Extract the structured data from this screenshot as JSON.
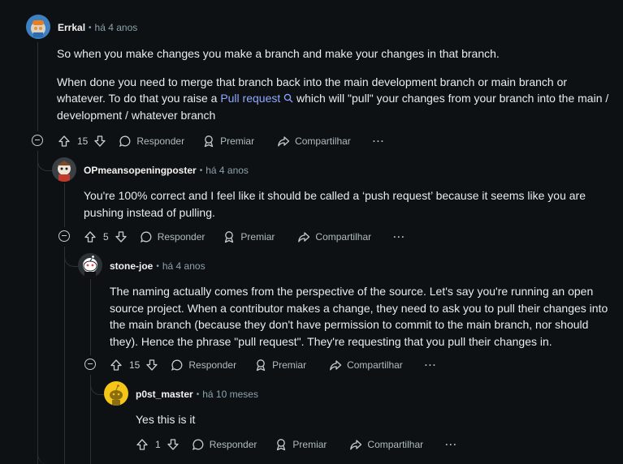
{
  "icons": {
    "upvote": "arrow-up-icon",
    "downvote": "arrow-down-icon",
    "reply": "chat-bubble-icon",
    "award": "award-icon",
    "share": "share-icon",
    "more": "ellipsis-icon",
    "collapse": "minus-circle-icon",
    "search": "search-icon"
  },
  "colors": {
    "background": "#0e1113",
    "link": "#8fa8ff",
    "muted": "#8ba2ad"
  },
  "actions": {
    "reply": "Responder",
    "award": "Premiar",
    "share": "Compartilhar",
    "more": "···"
  },
  "comments": [
    {
      "author": "Errkal",
      "time": "há 4 anos",
      "paragraphs": [
        "So when you make changes you make a branch and make your changes in that branch.",
        "When done you need to merge that branch back into the main development branch or main branch or whatever. To do that you raise a ",
        " which will \"pull\" your changes from your branch into the main / development / whatever branch"
      ],
      "link_text": "Pull request",
      "score": "15"
    },
    {
      "author": "OPmeansopeningposter",
      "time": "há 4 anos",
      "paragraphs": [
        "You're 100% correct and I feel like it should be called a ‘push request’ because it seems like you are pushing instead of pulling."
      ],
      "score": "5"
    },
    {
      "author": "stone-joe",
      "time": "há 4 anos",
      "paragraphs": [
        "The naming actually comes from the perspective of the source. Let's say you're running an open source project. When a contributor makes a change, they need to ask you to pull their changes into the main branch (because they don't have permission to commit to the main branch, nor should they). Hence the phrase \"pull request\". They're requesting that you pull their changes in."
      ],
      "score": "15"
    },
    {
      "author": "p0st_master",
      "time": "há 10 meses",
      "paragraphs": [
        "Yes this is it"
      ],
      "score": "1"
    }
  ]
}
